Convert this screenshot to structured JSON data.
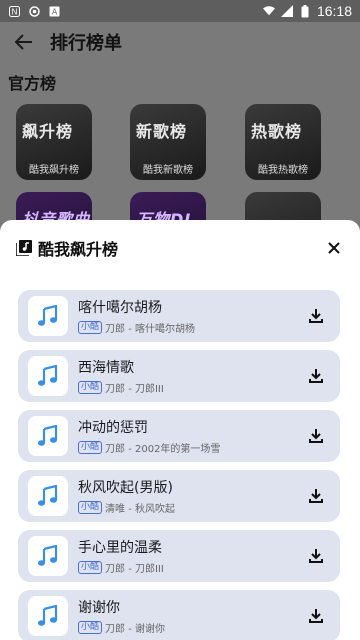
{
  "status_bar": {
    "time": "16:18",
    "icons": [
      "notification-n-icon",
      "circle-icon",
      "a-icon",
      "wifi-icon",
      "signal-icon",
      "battery-icon"
    ]
  },
  "app_bar": {
    "title": "排行榜单"
  },
  "section": {
    "title": "官方榜"
  },
  "tiles": [
    {
      "cover_text": "飙升榜",
      "label": "酷我飙升榜"
    },
    {
      "cover_text": "新歌榜",
      "label": "酷我新歌榜"
    },
    {
      "cover_text": "热歌榜",
      "label": "酷我热歌榜"
    },
    {
      "cover_text": "抖音歌曲",
      "label": ""
    },
    {
      "cover_text": "万物DJ",
      "label": ""
    },
    {
      "cover_text": "",
      "label": ""
    }
  ],
  "sheet": {
    "title": "酷我飙升榜",
    "songs": [
      {
        "name": "喀什噶尔胡杨",
        "badge": "小酷",
        "meta": "刀郎 - 喀什噶尔胡杨"
      },
      {
        "name": "西海情歌",
        "badge": "小酷",
        "meta": "刀郎 - 刀郎III"
      },
      {
        "name": "冲动的惩罚",
        "badge": "小酷",
        "meta": "刀郎 - 2002年的第一场雪"
      },
      {
        "name": "秋风吹起(男版)",
        "badge": "小酷",
        "meta": "清唯 - 秋风吹起"
      },
      {
        "name": "手心里的温柔",
        "badge": "小酷",
        "meta": "刀郎 - 刀郎III"
      },
      {
        "name": "谢谢你",
        "badge": "小酷",
        "meta": "刀郎 - 谢谢你"
      }
    ]
  },
  "colors": {
    "card_bg": "#dfe3f0",
    "badge": "#4a6fd1",
    "scrim": "#7a7a7a"
  }
}
